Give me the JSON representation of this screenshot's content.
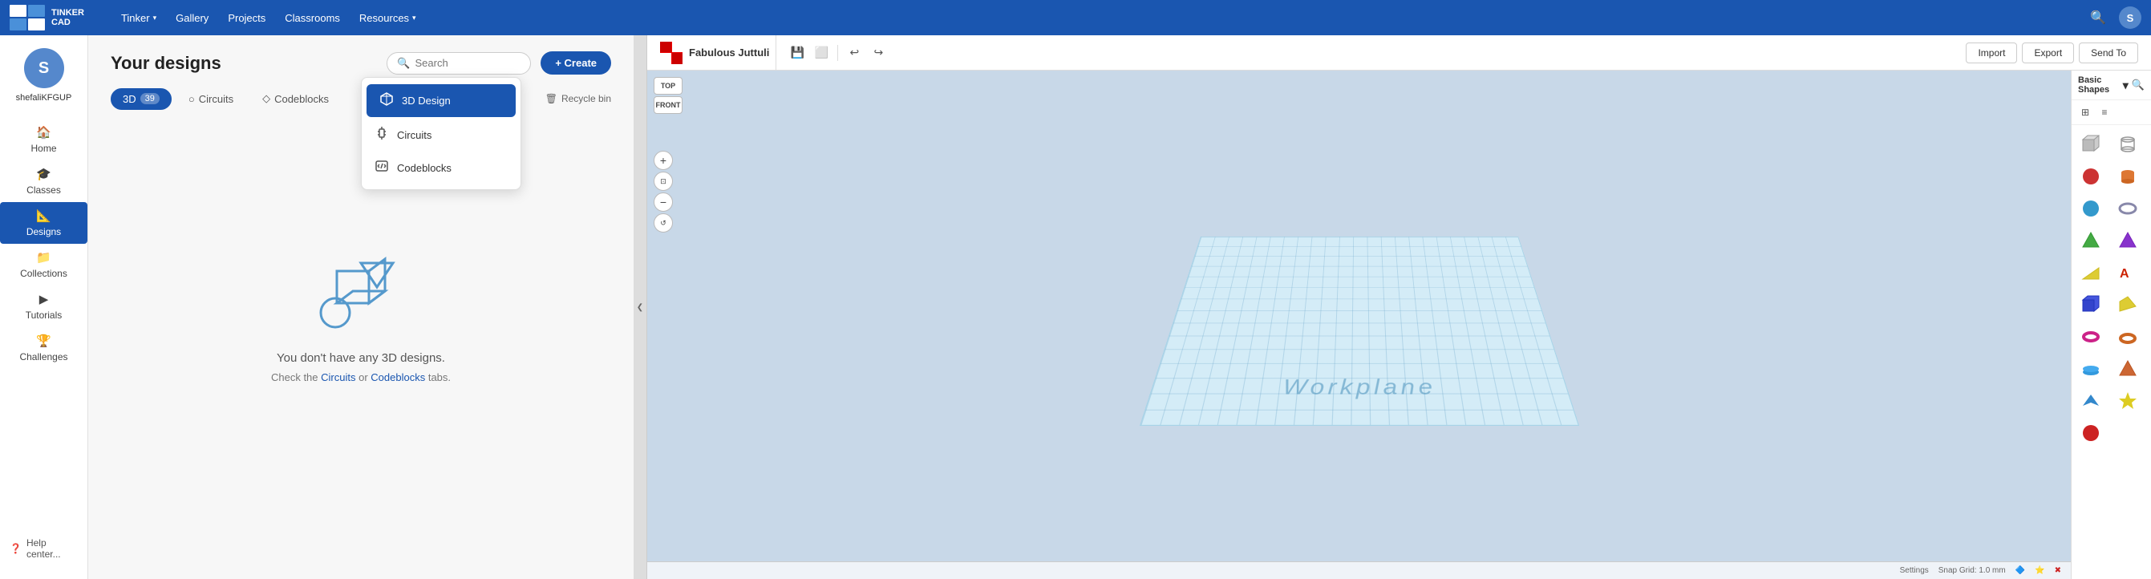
{
  "topNav": {
    "brand": "Autodesk Tinkercad",
    "logo_text_line1": "TINKER",
    "logo_text_line2": "CAD",
    "links": [
      {
        "label": "Tinker",
        "hasDropdown": true
      },
      {
        "label": "Gallery"
      },
      {
        "label": "Projects"
      },
      {
        "label": "Classrooms"
      },
      {
        "label": "Resources",
        "hasDropdown": true
      }
    ]
  },
  "sidebar": {
    "username": "shefaliKFGUP",
    "avatar_initial": "S",
    "items": [
      {
        "label": "Home",
        "icon": "🏠",
        "active": false
      },
      {
        "label": "Classes",
        "icon": "🎓",
        "active": false
      },
      {
        "label": "Designs",
        "icon": "📐",
        "active": true
      },
      {
        "label": "Collections",
        "icon": "📁",
        "active": false
      },
      {
        "label": "Tutorials",
        "icon": "▶",
        "active": false
      },
      {
        "label": "Challenges",
        "icon": "🏆",
        "active": false
      }
    ],
    "help_label": "Help center..."
  },
  "content": {
    "page_title": "Your designs",
    "search_placeholder": "Search",
    "create_label": "+ Create",
    "tabs": [
      {
        "label": "3D",
        "count": "39",
        "active": true
      },
      {
        "label": "Circuits",
        "icon": "○",
        "active": false
      },
      {
        "label": "Codeblocks",
        "icon": "◇",
        "active": false
      }
    ],
    "recycle_bin_label": "Recycle bin",
    "empty_state": {
      "main_text": "You don't have any 3D designs.",
      "sub_text_before": "Check the ",
      "circuits_link": "Circuits",
      "sub_text_middle": " or ",
      "codeblocks_link": "Codeblocks",
      "sub_text_after": " tabs."
    }
  },
  "dropdown": {
    "items": [
      {
        "label": "3D Design",
        "icon": "cube",
        "active": true
      },
      {
        "label": "Circuits",
        "icon": "circuit",
        "active": false
      },
      {
        "label": "Codeblocks",
        "icon": "code",
        "active": false
      }
    ]
  },
  "editor": {
    "title": "Fabulous Juttuli",
    "toolbar_buttons": [
      "save",
      "copy",
      "undo",
      "redo"
    ],
    "top_right_buttons": [
      "Import",
      "Export",
      "Send To"
    ],
    "view_top": "TOP",
    "view_front": "FRONT",
    "workplane_label": "Workplane",
    "shapes_panel_title": "Basic Shapes",
    "bottom_bar": {
      "settings": "Settings",
      "snap_grid": "Snap Grid",
      "snap_value": "1.0 mm"
    }
  },
  "shapes": [
    {
      "color": "#cccccc",
      "type": "box"
    },
    {
      "color": "#aaaaaa",
      "type": "cylinder-outline"
    },
    {
      "color": "#cc2222",
      "type": "sphere-red"
    },
    {
      "color": "#cc8833",
      "type": "cylinder-orange"
    },
    {
      "color": "#3399cc",
      "type": "sphere-blue"
    },
    {
      "color": "#888899",
      "type": "shape-gray"
    },
    {
      "color": "#44aa44",
      "type": "pyramid-green"
    },
    {
      "color": "#8833cc",
      "type": "pyramid-purple"
    },
    {
      "color": "#ddaa33",
      "type": "shape-yellow"
    },
    {
      "color": "#cc2200",
      "type": "text-red"
    },
    {
      "color": "#2244cc",
      "type": "box-blue"
    },
    {
      "color": "#ddcc33",
      "type": "wedge-yellow"
    },
    {
      "color": "#cc2288",
      "type": "torus-pink"
    },
    {
      "color": "#cc6622",
      "type": "torus-orange"
    },
    {
      "color": "#888888",
      "type": "shape-gray2"
    },
    {
      "color": "#3399dd",
      "type": "ellipse-blue"
    },
    {
      "color": "#cc4422",
      "type": "shape-brown"
    },
    {
      "color": "#cc2222",
      "type": "shape-red2"
    }
  ]
}
